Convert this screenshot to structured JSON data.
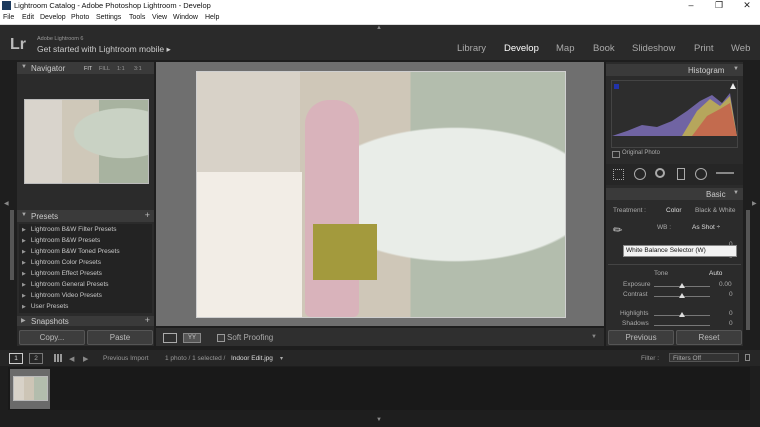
{
  "window": {
    "title": "Lightroom Catalog - Adobe Photoshop Lightroom - Develop",
    "controls": [
      "–",
      "❐",
      "✕"
    ]
  },
  "menu": [
    "File",
    "Edit",
    "Develop",
    "Photo",
    "Settings",
    "Tools",
    "View",
    "Window",
    "Help"
  ],
  "header": {
    "logo": "Lr",
    "version": "Adobe Lightroom 6",
    "mobile": "Get started with Lightroom mobile ▸",
    "modules": [
      "Library",
      "Develop",
      "Map",
      "Book",
      "Slideshow",
      "Print",
      "Web"
    ],
    "active_module": "Develop"
  },
  "left": {
    "navigator": {
      "title": "Navigator",
      "options": [
        "FIT",
        "FILL",
        "1:1",
        "3:1"
      ]
    },
    "presets": {
      "title": "Presets",
      "items": [
        "Lightroom B&W Filter Presets",
        "Lightroom B&W Presets",
        "Lightroom B&W Toned Presets",
        "Lightroom Color Presets",
        "Lightroom Effect Presets",
        "Lightroom General Presets",
        "Lightroom Video Presets",
        "User Presets"
      ]
    },
    "snapshots_title": "Snapshots",
    "copy_label": "Copy...",
    "paste_label": "Paste"
  },
  "toolbar": {
    "soft_proofing": "Soft Proofing"
  },
  "right": {
    "histogram_title": "Histogram",
    "original_photo": "Original Photo",
    "basic_title": "Basic",
    "treatment_label": "Treatment :",
    "treatment_color": "Color",
    "treatment_bw": "Black & White",
    "wb_label": "WB :",
    "wb_value": "As Shot ÷",
    "tooltip": "White Balance Selector (W)",
    "tone_label": "Tone",
    "auto_label": "Auto",
    "sliders": [
      {
        "label": "Exposure",
        "value": "0.00"
      },
      {
        "label": "Contrast",
        "value": "0"
      },
      {
        "label": "Highlights",
        "value": "0"
      },
      {
        "label": "Shadows",
        "value": "0"
      }
    ],
    "previous_label": "Previous",
    "reset_label": "Reset"
  },
  "filmstrip": {
    "tab1": "1",
    "tab2": "2",
    "source": "Previous Import",
    "count": "1 photo / 1 selected /",
    "filename": "Indoor Edit.jpg",
    "filter_label": "Filter :",
    "filter_value": "Filters Off"
  }
}
